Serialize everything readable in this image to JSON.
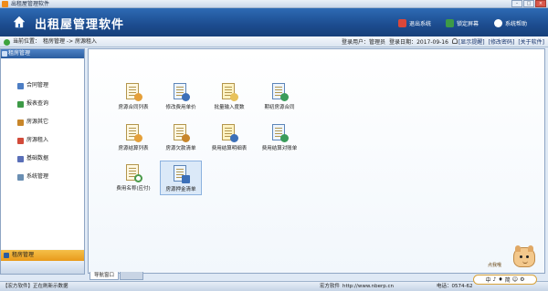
{
  "window": {
    "title": "出租屋管理软件"
  },
  "header": {
    "app_title": "出租屋管理软件",
    "exit_label": "退出系统",
    "lock_label": "锁定屏幕",
    "help_label": "系统帮助"
  },
  "infobar": {
    "location_label": "当前位置：",
    "location_path": "租房管理 -> 房源租入",
    "user_label": "登录用户：",
    "user_value": "管理员",
    "date_label": "登录日期：",
    "date_value": "2017-09-16",
    "reminder_link": "[显示提醒]",
    "password_link": "[修改密码]",
    "about_link": "[关于软件]"
  },
  "sidebar": {
    "header": "租房管理",
    "items": [
      {
        "label": "合同管理",
        "color": "#4d7ec4"
      },
      {
        "label": "报表查询",
        "color": "#3d9a47"
      },
      {
        "label": "房源其它",
        "color": "#c8862a"
      },
      {
        "label": "房源租入",
        "color": "#d24b3a"
      },
      {
        "label": "基础数据",
        "color": "#5a6fb8"
      },
      {
        "label": "系统管理",
        "color": "#6a8fb3"
      }
    ],
    "footer": "租房管理"
  },
  "tiles": [
    {
      "label": "房源合同列表",
      "badge": "#e5a03a"
    },
    {
      "label": "修改费用单价",
      "badge": "#3b6fb8"
    },
    {
      "label": "批量输入度数",
      "badge": "#e8c25a"
    },
    {
      "label": "期初房源合同",
      "badge": "#3a9c5a"
    },
    {
      "label": "房源结算列表",
      "badge": "#e5a03a"
    },
    {
      "label": "房源欠款清单",
      "badge": "#c8862a"
    },
    {
      "label": "费用结算明细表",
      "badge": "#3b6fb8"
    },
    {
      "label": "费用结算对账单",
      "badge": "#3a9c5a"
    },
    {
      "label": "费用名称(应付)",
      "badge": "#4a9a4a"
    },
    {
      "label": "房源押金清单",
      "badge": "#3b6fb8"
    }
  ],
  "tabs": [
    {
      "label": "导航窗口"
    },
    {
      "label": ""
    }
  ],
  "status": {
    "left": "【宏方软件】正在刷新示数据",
    "company": "宏方软件",
    "url": "http://www.nberp.cn",
    "phone_label": "电话：",
    "phone_value": "0574-62"
  },
  "mascot": {
    "hint": "点我哦",
    "chars": [
      "中",
      "♪",
      "♦",
      "简",
      "☺",
      "⚙"
    ]
  }
}
